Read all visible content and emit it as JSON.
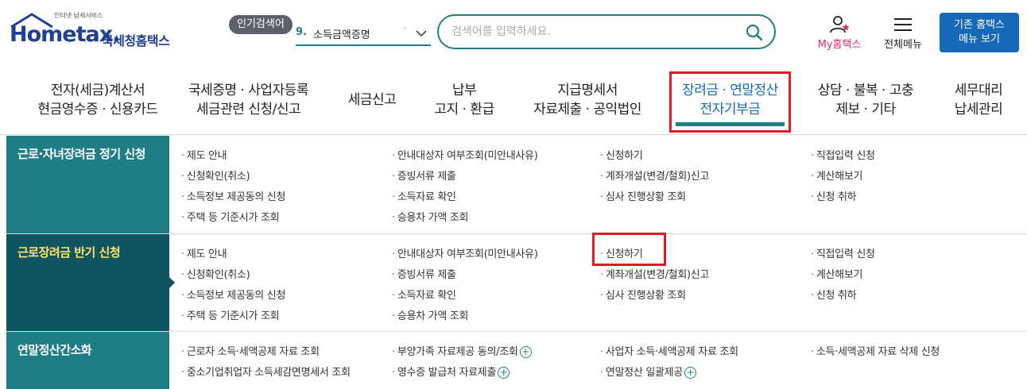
{
  "header": {
    "logo_small": "인터넷 납세서비스",
    "logo_main": "Hometax.",
    "logo_kr": "국세청홈택스",
    "popular_badge": "인기검색어",
    "popular_num": "9.",
    "popular_term": "소득금액증명",
    "search_placeholder": "검색어를 입력하세요.",
    "myhome_label": "My홈택스",
    "allmenu_label": "전체메뉴",
    "old_btn_line1": "기존 홈택스",
    "old_btn_line2": "메뉴 보기"
  },
  "gnb": [
    {
      "line1": "전자(세금)계산서",
      "line2": "현금영수증 · 신용카드"
    },
    {
      "line1": "국세증명 · 사업자등록",
      "line2": "세금관련 신청/신고"
    },
    {
      "line1": "세금신고",
      "line2": ""
    },
    {
      "line1": "납부",
      "line2": "고지 · 환급"
    },
    {
      "line1": "지급명세서",
      "line2": "자료제출 · 공익법인"
    },
    {
      "line1": "장려금 · 연말정산",
      "line2": "전자기부금"
    },
    {
      "line1": "상담 · 불복 · 고충",
      "line2": "제보 · 기타"
    },
    {
      "line1": "세무대리",
      "line2": "납세관리"
    }
  ],
  "sections": [
    {
      "title": "근로·자녀장려금 정기 신청",
      "links": [
        [
          "제도 안내",
          "안내대상자 여부조회(미안내사유)",
          "신청하기",
          "직접입력 신청"
        ],
        [
          "신청확인(취소)",
          "증빙서류 제출",
          "계좌개설(변경/철회)신고",
          "계산해보기"
        ],
        [
          "소득정보 제공동의 신청",
          "소득자료 확인",
          "심사 진행상황 조회",
          "신청 취하"
        ],
        [
          "주택 등 기준시가 조회",
          "승용차 가액 조회"
        ]
      ]
    },
    {
      "title": "근로장려금 반기 신청",
      "links": [
        [
          "제도 안내",
          "안내대상자 여부조회(미안내사유)",
          "신청하기",
          "직접입력 신청"
        ],
        [
          "신청확인(취소)",
          "증빙서류 제출",
          "계좌개설(변경/철회)신고",
          "계산해보기"
        ],
        [
          "소득정보 제공동의 신청",
          "소득자료 확인",
          "심사 진행상황 조회",
          "신청 취하"
        ],
        [
          "주택 등 기준시가 조회",
          "승용차 가액 조회"
        ]
      ]
    },
    {
      "title": "연말정산간소화",
      "links": [
        [
          "근로자 소득·세액공제 자료 조회",
          "부양가족 자료제공 동의/조회",
          "사업자 소득·세액공제 자료 조회",
          "소득·세액공제 자료 삭제 신청"
        ],
        [
          "중소기업취업자 소득세감면명세서 조회",
          "영수증 발급처 자료제출",
          "연말정산 일괄제공"
        ]
      ]
    }
  ],
  "colors": {
    "teal": "#1f7d86",
    "dark_teal": "#0f5560",
    "active_blue": "#1769b7",
    "highlight_red": "#e01b24",
    "myhome_pink": "#e02d64"
  }
}
